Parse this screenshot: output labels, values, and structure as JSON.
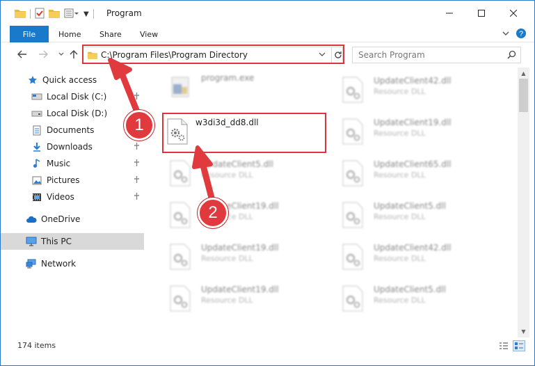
{
  "window": {
    "title": "Program"
  },
  "ribbon": {
    "tabs": [
      "File",
      "Home",
      "Share",
      "View"
    ]
  },
  "address": {
    "path": "C:\\Program Files\\Program Directory"
  },
  "search": {
    "placeholder": "Search Program"
  },
  "sidebar": {
    "items": [
      {
        "label": "Quick access",
        "icon": "star-icon",
        "pinned": false
      },
      {
        "label": "Local Disk (C:)",
        "icon": "drive-icon",
        "pinned": true
      },
      {
        "label": "Local Disk (D:)",
        "icon": "drive-icon",
        "pinned": false
      },
      {
        "label": "Documents",
        "icon": "documents-icon",
        "pinned": true
      },
      {
        "label": "Downloads",
        "icon": "download-icon",
        "pinned": true
      },
      {
        "label": "Music",
        "icon": "music-icon",
        "pinned": true
      },
      {
        "label": "Pictures",
        "icon": "pictures-icon",
        "pinned": true
      },
      {
        "label": "Videos",
        "icon": "videos-icon",
        "pinned": true
      },
      {
        "label": "OneDrive",
        "icon": "cloud-icon",
        "pinned": false
      },
      {
        "label": "This PC",
        "icon": "computer-icon",
        "pinned": false,
        "selected": true
      },
      {
        "label": "Network",
        "icon": "network-icon",
        "pinned": false
      }
    ]
  },
  "files": {
    "left": [
      {
        "name": "program.exe",
        "type": ""
      },
      {
        "name": "w3di3d_dd8.dll",
        "type": ""
      },
      {
        "name": "UpdateClient5.dll",
        "type": "Resource DLL"
      },
      {
        "name": "UpdateClient19.dll",
        "type": "Resource DLL"
      },
      {
        "name": "UpdateClient19.dll",
        "type": "Resource DLL"
      },
      {
        "name": "UpdateClient19.dll",
        "type": "Resource DLL"
      }
    ],
    "right": [
      {
        "name": "UpdateClient42.dll",
        "type": "Resource DLL"
      },
      {
        "name": "UpdateClient19.dll",
        "type": "Resource DLL"
      },
      {
        "name": "UpdateClient65.dll",
        "type": "Resource DLL"
      },
      {
        "name": "UpdateClient5.dll",
        "type": "Resource DLL"
      },
      {
        "name": "UpdateClient42.dll",
        "type": "Resource DLL"
      },
      {
        "name": "UpdateClient5.dll",
        "type": "Resource DLL"
      }
    ]
  },
  "status": {
    "item_count": "174 items"
  },
  "annotations": {
    "step1": "1",
    "step2": "2",
    "color": "#e0393e"
  }
}
